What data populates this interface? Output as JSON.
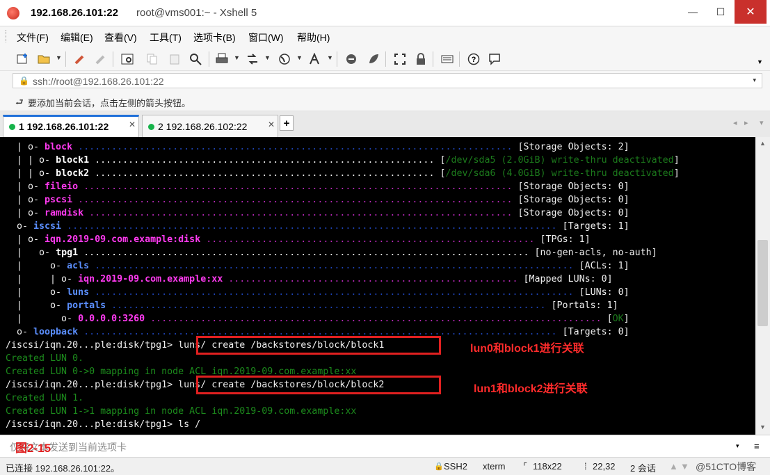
{
  "window": {
    "title_host": "192.168.26.101:22",
    "title_rest": "root@vms001:~ - Xshell 5",
    "min_icon": "—",
    "max_icon": "☐",
    "close_icon": "✕"
  },
  "menu": [
    "文件(F)",
    "编辑(E)",
    "查看(V)",
    "工具(T)",
    "选项卡(B)",
    "窗口(W)",
    "帮助(H)"
  ],
  "address": {
    "value": "ssh://root@192.168.26.101:22",
    "dropdown": "▾"
  },
  "hint": {
    "text": "要添加当前会话，点击左侧的箭头按钮。"
  },
  "tabs": [
    {
      "label": "1 192.168.26.101:22",
      "close": "✕"
    },
    {
      "label": "2 192.168.26.102:22",
      "close": "✕"
    }
  ],
  "tab_add": "+",
  "tab_nav": {
    "prev": "◂",
    "next": "▸",
    "menu": "▾"
  },
  "terminal": {
    "lines": [
      {
        "segments": [
          {
            "t": "  | o- ",
            "c": "w"
          },
          {
            "t": "block",
            "c": "m"
          },
          {
            "t": " .............................................................................. ",
            "c": "d"
          },
          {
            "t": "[Storage Objects: 2]",
            "c": "w"
          }
        ]
      },
      {
        "segments": [
          {
            "t": "  | | o- ",
            "c": "w"
          },
          {
            "t": "block1",
            "c": "wb"
          },
          {
            "t": " ............................................................. ",
            "c": "w"
          },
          {
            "t": "[",
            "c": "w"
          },
          {
            "t": "/dev/sda5 (2.0GiB) write-thru deactivated",
            "c": "dg"
          },
          {
            "t": "]",
            "c": "w"
          }
        ]
      },
      {
        "segments": [
          {
            "t": "  | | o- ",
            "c": "w"
          },
          {
            "t": "block2",
            "c": "wb"
          },
          {
            "t": " ............................................................. ",
            "c": "w"
          },
          {
            "t": "[",
            "c": "w"
          },
          {
            "t": "/dev/sda6 (4.0GiB) write-thru deactivated",
            "c": "dg"
          },
          {
            "t": "]",
            "c": "w"
          }
        ]
      },
      {
        "segments": [
          {
            "t": "  | o- ",
            "c": "w"
          },
          {
            "t": "fileio",
            "c": "m"
          },
          {
            "t": " ............................................................................. ",
            "c": "dm"
          },
          {
            "t": "[Storage Objects: 0]",
            "c": "w"
          }
        ]
      },
      {
        "segments": [
          {
            "t": "  | o- ",
            "c": "w"
          },
          {
            "t": "pscsi",
            "c": "m"
          },
          {
            "t": " .............................................................................. ",
            "c": "dm"
          },
          {
            "t": "[Storage Objects: 0]",
            "c": "w"
          }
        ]
      },
      {
        "segments": [
          {
            "t": "  | o- ",
            "c": "w"
          },
          {
            "t": "ramdisk",
            "c": "m"
          },
          {
            "t": " ............................................................................ ",
            "c": "dm"
          },
          {
            "t": "[Storage Objects: 0]",
            "c": "w"
          }
        ]
      },
      {
        "segments": [
          {
            "t": "  o- ",
            "c": "w"
          },
          {
            "t": "iscsi",
            "c": "b"
          },
          {
            "t": " ........................................................................................ ",
            "c": "d"
          },
          {
            "t": "[Targets: 1]",
            "c": "w"
          }
        ]
      },
      {
        "segments": [
          {
            "t": "  | o- ",
            "c": "w"
          },
          {
            "t": "iqn.2019-09.com.example:disk",
            "c": "m"
          },
          {
            "t": " ........................................................... ",
            "c": "dm"
          },
          {
            "t": "[TPGs: 1]",
            "c": "w"
          }
        ]
      },
      {
        "segments": [
          {
            "t": "  |   o- ",
            "c": "w"
          },
          {
            "t": "tpg1",
            "c": "wb"
          },
          {
            "t": " ................................................................................ ",
            "c": "w"
          },
          {
            "t": "[no-gen-acls, no-auth]",
            "c": "w"
          }
        ]
      },
      {
        "segments": [
          {
            "t": "  |     o- ",
            "c": "w"
          },
          {
            "t": "acls",
            "c": "b"
          },
          {
            "t": " ...................................................................................... ",
            "c": "d"
          },
          {
            "t": "[ACLs: 1]",
            "c": "w"
          }
        ]
      },
      {
        "segments": [
          {
            "t": "  |     | o- ",
            "c": "w"
          },
          {
            "t": "iqn.2019-09.com.example:xx",
            "c": "m"
          },
          {
            "t": " .................................................... ",
            "c": "dm"
          },
          {
            "t": "[Mapped LUNs: 0]",
            "c": "w"
          }
        ]
      },
      {
        "segments": [
          {
            "t": "  |     o- ",
            "c": "w"
          },
          {
            "t": "luns",
            "c": "b"
          },
          {
            "t": " ...................................................................................... ",
            "c": "d"
          },
          {
            "t": "[LUNs: 0]",
            "c": "w"
          }
        ]
      },
      {
        "segments": [
          {
            "t": "  |     o- ",
            "c": "w"
          },
          {
            "t": "portals",
            "c": "b"
          },
          {
            "t": " .............................................................................. ",
            "c": "d"
          },
          {
            "t": "[Portals: 1]",
            "c": "w"
          }
        ]
      },
      {
        "segments": [
          {
            "t": "  |       o- ",
            "c": "w"
          },
          {
            "t": "0.0.0.0:3260",
            "c": "m"
          },
          {
            "t": " ................................................................................. ",
            "c": "dm"
          },
          {
            "t": "[",
            "c": "w"
          },
          {
            "t": "OK",
            "c": "dg"
          },
          {
            "t": "]",
            "c": "w"
          }
        ]
      },
      {
        "segments": [
          {
            "t": "  o- ",
            "c": "w"
          },
          {
            "t": "loopback",
            "c": "b"
          },
          {
            "t": " ..................................................................................... ",
            "c": "d"
          },
          {
            "t": "[Targets: 0]",
            "c": "w"
          }
        ]
      },
      {
        "segments": [
          {
            "t": "/iscsi/iqn.20...ple:disk/tpg1> luns/ create /backstores/block/block1",
            "c": "w"
          }
        ]
      },
      {
        "segments": [
          {
            "t": "Created LUN 0.",
            "c": "g"
          }
        ]
      },
      {
        "segments": [
          {
            "t": "Created LUN 0->0 mapping in node ACL iqn.2019-09.com.example:xx",
            "c": "g"
          }
        ]
      },
      {
        "segments": [
          {
            "t": "/iscsi/iqn.20...ple:disk/tpg1> luns/ create /backstores/block/block2",
            "c": "w"
          }
        ]
      },
      {
        "segments": [
          {
            "t": "Created LUN 1.",
            "c": "g"
          }
        ]
      },
      {
        "segments": [
          {
            "t": "Created LUN 1->1 mapping in node ACL iqn.2019-09.com.example:xx",
            "c": "g"
          }
        ]
      },
      {
        "segments": [
          {
            "t": "/iscsi/iqn.20...ple:disk/tpg1> ls /",
            "c": "w"
          }
        ]
      }
    ],
    "annotations": [
      "lun0和block1进行关联",
      "lun1和block2进行关联"
    ]
  },
  "compose": {
    "placeholder": "仅将文本发送到当前选项卡",
    "figure_label": "图2-15",
    "dropdown": "▾",
    "menu": "≡"
  },
  "status": {
    "connected": "已连接 192.168.26.101:22。",
    "protocol": "SSH2",
    "term": "xterm",
    "size": "118x22",
    "cursor": "22,32",
    "sessions": "2 会话",
    "watermark": "@51CTO博客"
  },
  "toolbar_icons": [
    "new-session-icon",
    "open-folder-icon",
    "reconnect-icon",
    "disconnect-icon",
    "properties-icon",
    "copy-icon",
    "paste-icon",
    "find-icon",
    "print-icon",
    "transfer-icon",
    "globe-icon",
    "font-icon",
    "xftp-icon",
    "xmanager-icon",
    "fullscreen-icon",
    "lock-icon",
    "keyboard-icon",
    "help-icon",
    "chat-icon"
  ],
  "colors": {
    "accent": "#1e6fd9",
    "close_red": "#c9302c",
    "annotation_red": "#e02020",
    "terminal_bg": "#000000"
  }
}
